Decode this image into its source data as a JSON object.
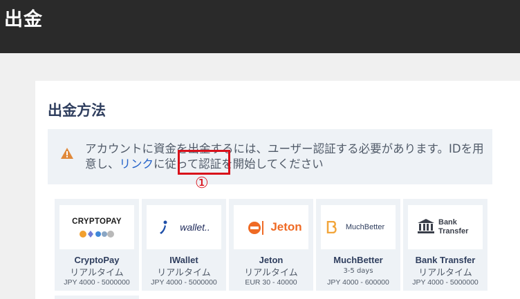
{
  "header": {
    "title": "出金"
  },
  "section": {
    "title": "出金方法"
  },
  "notice": {
    "text_before": "アカウントに資金を出金するには、ユーザー認証する必要があります。IDを用意し、",
    "link_label": "リンク",
    "text_after": "に従って認証を開始してください"
  },
  "annotation": {
    "number": "①"
  },
  "methods": [
    {
      "name": "CryptoPay",
      "speed": "リアルタイム",
      "limit": "JPY 4000 - 5000000",
      "logo_icon": "cryptopay-logo",
      "logo_text": "CRYPTOPAY"
    },
    {
      "name": "IWallet",
      "speed": "リアルタイム",
      "limit": "JPY 4000 - 5000000",
      "logo_icon": "iwallet-logo",
      "logo_text": "wallet.."
    },
    {
      "name": "Jeton",
      "speed": "リアルタイム",
      "limit": "EUR 30 - 40000",
      "logo_icon": "jeton-logo",
      "logo_text": "Jeton"
    },
    {
      "name": "MuchBetter",
      "speed": "3-5 days",
      "limit": "JPY 4000 - 600000",
      "logo_icon": "muchbetter-logo",
      "logo_text": "MuchBetter"
    },
    {
      "name": "Bank Transfer",
      "speed": "リアルタイム",
      "limit": "JPY 4000 - 5000000",
      "logo_icon": "bank-icon",
      "logo_text_line1": "Bank",
      "logo_text_line2": "Transfer"
    }
  ],
  "colors": {
    "header_bg": "#2a2a2a",
    "title": "#2f3e5e",
    "link": "#2563c9",
    "warning": "#e0893a",
    "highlight": "#d9101a",
    "jeton": "#ef6a24",
    "muchbetter": "#f2a53a"
  }
}
